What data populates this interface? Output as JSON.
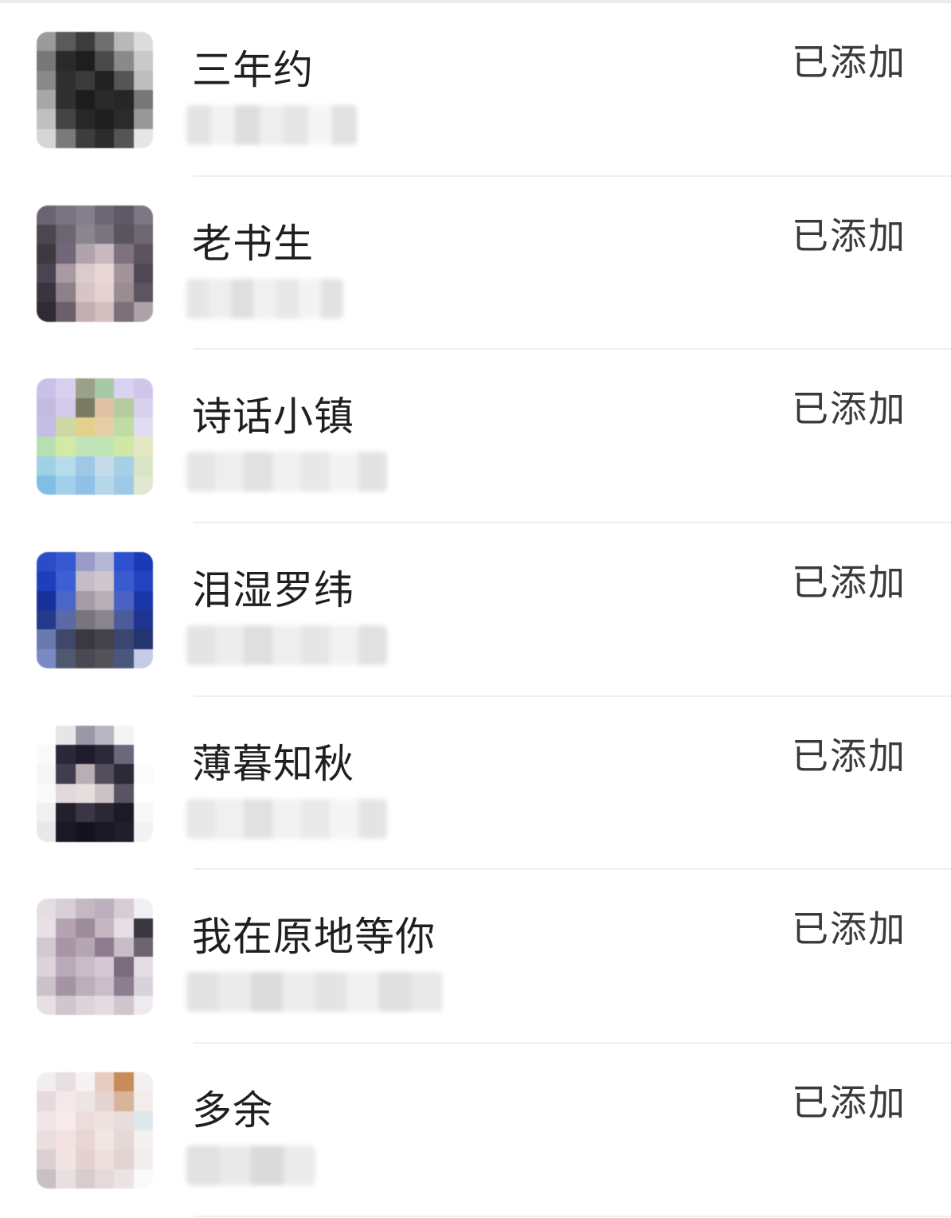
{
  "contacts": [
    {
      "name": "三年约",
      "status": "已添加",
      "avatar_colors": [
        "#9a9a9a",
        "#5a5a5a",
        "#3c3c3c",
        "#6f6f6f",
        "#b8b8b8",
        "#dcdcdc",
        "#777",
        "#2a2a2a",
        "#1e1e1e",
        "#4a4a4a",
        "#8a8a8a",
        "#c9c9c9",
        "#8a8a8a",
        "#2f2f2f",
        "#3a3a3a",
        "#222",
        "#555",
        "#bdbdbd",
        "#a7a7a7",
        "#303030",
        "#1c1c1c",
        "#2a2a2a",
        "#262626",
        "#777",
        "#c0c0c0",
        "#444",
        "#272727",
        "#1f1f1f",
        "#2b2b2b",
        "#999",
        "#d6d6d6",
        "#7a7a7a",
        "#3d3d3d",
        "#2c2c2c",
        "#555",
        "#e6e6e6"
      ],
      "sub_colors": [
        "#e0e0e0",
        "#f0f0f0",
        "#d8d8d8",
        "#ececec",
        "#e2e2e2",
        "#f4f4f4",
        "#dcdcdc"
      ]
    },
    {
      "name": "老书生",
      "status": "已添加",
      "avatar_colors": [
        "#6a6470",
        "#7a7480",
        "#857f8b",
        "#6d6773",
        "#5f5965",
        "#7d7783",
        "#4c4650",
        "#6c6670",
        "#8b8590",
        "#7a747e",
        "#5a545e",
        "#6e6872",
        "#3e3840",
        "#70687a",
        "#b0a3ab",
        "#c9b9be",
        "#7e727e",
        "#5b545e",
        "#4a4450",
        "#a89aa2",
        "#dccbcc",
        "#e8d7d6",
        "#a3949c",
        "#4f4754",
        "#3a343e",
        "#8e8089",
        "#d8c4c4",
        "#e6d2d0",
        "#9a8c93",
        "#5c545e",
        "#2f2a33",
        "#6c6068",
        "#c2afb2",
        "#d3bfc0",
        "#7e7078",
        "#aca2a8"
      ],
      "sub_colors": [
        "#e2e2e2",
        "#ececec",
        "#dadada",
        "#eeeeee",
        "#e4e4e4",
        "#f2f2f2",
        "#dedede"
      ]
    },
    {
      "name": "诗话小镇",
      "status": "已添加",
      "avatar_colors": [
        "#c9c1e6",
        "#d8d0ee",
        "#9aa08a",
        "#a7c9a8",
        "#d9d3ef",
        "#cfc6ea",
        "#c3bbe0",
        "#d2cbec",
        "#7a7a62",
        "#e2c2a5",
        "#b6cca0",
        "#d8d1ee",
        "#c6bde2",
        "#cdd8a4",
        "#e4d08a",
        "#e6cfa6",
        "#c0dba4",
        "#e0dcf2",
        "#b6e0b0",
        "#d3eaa6",
        "#c0e4ba",
        "#bfe6b6",
        "#cfe8a8",
        "#e4e7c4",
        "#9fd0e6",
        "#b4dcea",
        "#9fc7e6",
        "#c4dcea",
        "#a7cfe6",
        "#d8e4c6",
        "#7fbfe6",
        "#a3d1ec",
        "#8fc2e6",
        "#b6d6ea",
        "#9fc9e8",
        "#e0e8d0"
      ],
      "sub_colors": [
        "#e2e2e2",
        "#ececec",
        "#dcdcdc",
        "#eeeeee",
        "#e4e4e4",
        "#f2f2f2",
        "#dedede"
      ]
    },
    {
      "name": "泪湿罗纬",
      "status": "已添加",
      "avatar_colors": [
        "#2a4cc8",
        "#3658d0",
        "#9a9cc8",
        "#b4b8d6",
        "#2b50d0",
        "#1a3ab8",
        "#1f3fba",
        "#3d5fd4",
        "#c4bcc8",
        "#d0c6cc",
        "#3a5ad0",
        "#2244c0",
        "#18309a",
        "#4a66c8",
        "#a69ca6",
        "#b8aeb6",
        "#4a62c4",
        "#1a36a8",
        "#223a8a",
        "#5a6aa6",
        "#7a7480",
        "#8a8490",
        "#4c5c9a",
        "#1e3490",
        "#6a7ab0",
        "#40486a",
        "#3a3840",
        "#44424a",
        "#3a4670",
        "#24346e",
        "#7a88c4",
        "#505870",
        "#4a4850",
        "#545258",
        "#4a5680",
        "#c4cce6"
      ],
      "sub_colors": [
        "#e0e0e0",
        "#eaeaea",
        "#dadada",
        "#ececec",
        "#e2e2e2",
        "#f0f0f0",
        "#dcdcdc"
      ]
    },
    {
      "name": "薄暮知秋",
      "status": "已添加",
      "avatar_colors": [
        "#ffffff",
        "#e6e6e8",
        "#9a98a6",
        "#b8b6c2",
        "#f4f4f4",
        "#ffffff",
        "#fafafa",
        "#2a2838",
        "#1e1c2c",
        "#2c2a3a",
        "#6a687a",
        "#ffffff",
        "#f6f6f6",
        "#403e4e",
        "#b8aeb4",
        "#544e5c",
        "#2c2a38",
        "#fbfbfb",
        "#fafafa",
        "#e0d8dc",
        "#e6ddde",
        "#cbc2c6",
        "#5a5462",
        "#ffffff",
        "#f0f0f2",
        "#22202c",
        "#3a3646",
        "#2a2834",
        "#1c1a28",
        "#f8f8f8",
        "#e8e8ea",
        "#1a1826",
        "#14121e",
        "#1a1826",
        "#201e2c",
        "#f2f2f2"
      ],
      "sub_colors": [
        "#e4e4e4",
        "#eeeeee",
        "#dcdcdc",
        "#f0f0f0",
        "#e6e6e6",
        "#f4f4f4",
        "#e0e0e0"
      ]
    },
    {
      "name": "我在原地等你",
      "status": "已添加",
      "avatar_colors": [
        "#e4dde2",
        "#d8ced6",
        "#c4b8c2",
        "#bcaeba",
        "#d6ccd4",
        "#f0f0f2",
        "#e8e0e6",
        "#b4a4b2",
        "#9c8c9c",
        "#c6b6c2",
        "#e6e0e6",
        "#3a3640",
        "#d2c8d0",
        "#a896a6",
        "#b6a6b4",
        "#8e7c8e",
        "#c8bcc6",
        "#6c6470",
        "#dcd4da",
        "#b8aab8",
        "#c8bcc6",
        "#d4c8d2",
        "#7a6c7c",
        "#e4dee4",
        "#ccc2ca",
        "#a494a4",
        "#bcaebc",
        "#cabeca",
        "#8c7e8e",
        "#d8d2da",
        "#e6e0e4",
        "#d0c6ce",
        "#dcd4da",
        "#e2dce2",
        "#cfc6ce",
        "#eeeaee"
      ],
      "sub_colors": [
        "#dedede",
        "#e8e8e8",
        "#d6d6d6",
        "#eaeaea",
        "#e0e0e0",
        "#eeeeee",
        "#dadada",
        "#e6e6e6"
      ]
    },
    {
      "name": "多余",
      "status": "已添加",
      "avatar_colors": [
        "#f2eef0",
        "#e8dfe2",
        "#f6f2f4",
        "#e8ccc0",
        "#c88c5a",
        "#f4f0f0",
        "#e6dade",
        "#f4e8e8",
        "#efe4e4",
        "#e6d4d0",
        "#d8b49a",
        "#f2ecec",
        "#f0e6e8",
        "#f8eaea",
        "#ecdcdc",
        "#f0e2e0",
        "#e8dcdc",
        "#dee8ec",
        "#eadede",
        "#f4e2e0",
        "#e8d6d4",
        "#f2e6e4",
        "#e6d8d6",
        "#f4f0f0",
        "#dcd0d2",
        "#f2e4e2",
        "#e4d2d0",
        "#eee0de",
        "#e2d4d2",
        "#f2eeee",
        "#c8c0c4",
        "#e8e0e0",
        "#d8cccc",
        "#e4dada",
        "#ece4e4",
        "#faf8f8"
      ],
      "sub_colors": [
        "#dcdcdc",
        "#e6e6e6",
        "#d4d4d4",
        "#e8e8e8"
      ]
    }
  ]
}
